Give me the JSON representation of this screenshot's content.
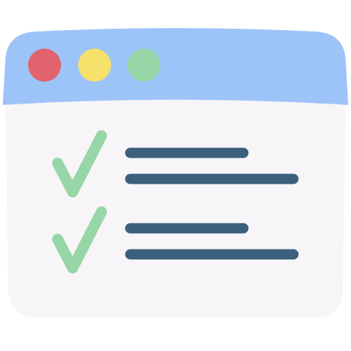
{
  "illustration": {
    "kind": "browser-window-checklist-icon",
    "window_controls": [
      {
        "name": "close",
        "color": "#e0636e"
      },
      {
        "name": "minimize",
        "color": "#f6e16a"
      },
      {
        "name": "maximize",
        "color": "#97d6a6"
      }
    ],
    "colors": {
      "titlebar": "#9dc4f8",
      "body": "#f7f5f8",
      "check": "#97d6a6",
      "text_line": "#3b5f7d"
    },
    "checklist": [
      {
        "checked": true,
        "lines": 2
      },
      {
        "checked": true,
        "lines": 2
      }
    ]
  }
}
